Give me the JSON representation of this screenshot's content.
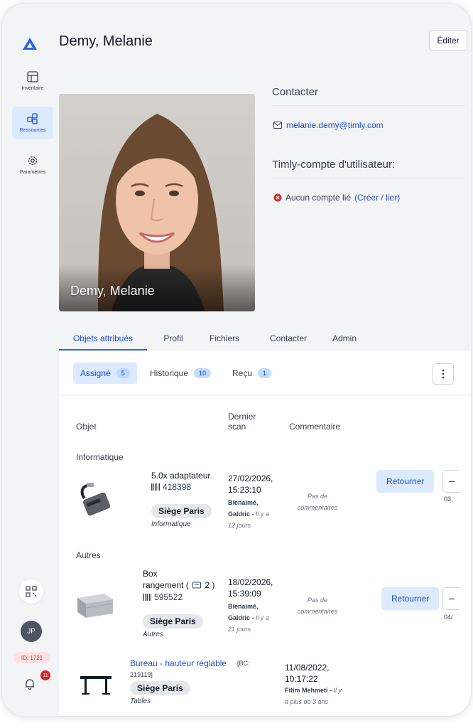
{
  "sidebar": {
    "items": [
      {
        "label": "Inventaire",
        "icon": "grid-icon"
      },
      {
        "label": "Ressources",
        "icon": "resources-icon",
        "active": true
      },
      {
        "label": "Paramètres",
        "icon": "gear-icon"
      }
    ],
    "avatar_initials": "JP",
    "id_badge": "ID: 1721",
    "notification_count": "11"
  },
  "header": {
    "title": "Demy, Melanie",
    "edit_label": "Éditer"
  },
  "profile": {
    "photo_name": "Demy, Melanie"
  },
  "contact": {
    "heading": "Contacter",
    "email": "melanie.demy@timly.com",
    "account_heading": "Timly-compte d'utilisateur:",
    "no_account": "Aucun compte lié",
    "create_link": "(Créer / lier)"
  },
  "tabs": [
    "Objets attribués",
    "Profil",
    "Fichiers",
    "Contacter",
    "Admin"
  ],
  "subtabs": [
    {
      "label": "Assigné",
      "count": "5"
    },
    {
      "label": "Historique",
      "count": "10"
    },
    {
      "label": "Reçu",
      "count": "1"
    }
  ],
  "table": {
    "headers": {
      "object": "Objet",
      "scan_line1": "Dernier",
      "scan_line2": "scan",
      "comment": "Commentaire"
    },
    "groups": [
      "Informatique",
      "Autres"
    ],
    "rows": [
      {
        "name": "5.0x adaptateur",
        "code": "418398",
        "site": "Siège Paris",
        "category": "Informatique",
        "scan_date": "27/02/2026,",
        "scan_time": "15:23:10",
        "scan_by1": "Bienaimé,",
        "scan_by2": "Galdric -",
        "scan_ago1": "Il y a",
        "scan_ago2": "12 jours",
        "comment1": "Pas de",
        "comment2": "commentaires",
        "action": "Retourner",
        "date_cut": "03,"
      },
      {
        "name1": "Box",
        "name2": "rangement (",
        "name_count": "2 )",
        "code": "595522",
        "site": "Siège Paris",
        "category": "Autres",
        "scan_date": "18/02/2026,",
        "scan_time": "15:39:09",
        "scan_by1": "Bienaimé,",
        "scan_by2": "Galdric -",
        "scan_ago1": "Il y a",
        "scan_ago2": "21 jours",
        "comment1": "Pas de",
        "comment2": "commentaires",
        "action": "Retourner",
        "date_cut": "04/"
      },
      {
        "name": "Bureau - hauteur réglable",
        "bc1": "[BC:",
        "bc2": "219119]",
        "site": "Siège Paris",
        "category": "Tables",
        "scan_date": "11/08/2022,",
        "scan_time": "10:17:22",
        "scan_by": "Fitim Mehmeti -",
        "scan_ago1": "Il y",
        "scan_ago2": "a plus de 3 ans"
      }
    ]
  },
  "colors": {
    "accent": "#2563eb",
    "accent_bg": "#dbeafe",
    "danger": "#dc2626"
  }
}
